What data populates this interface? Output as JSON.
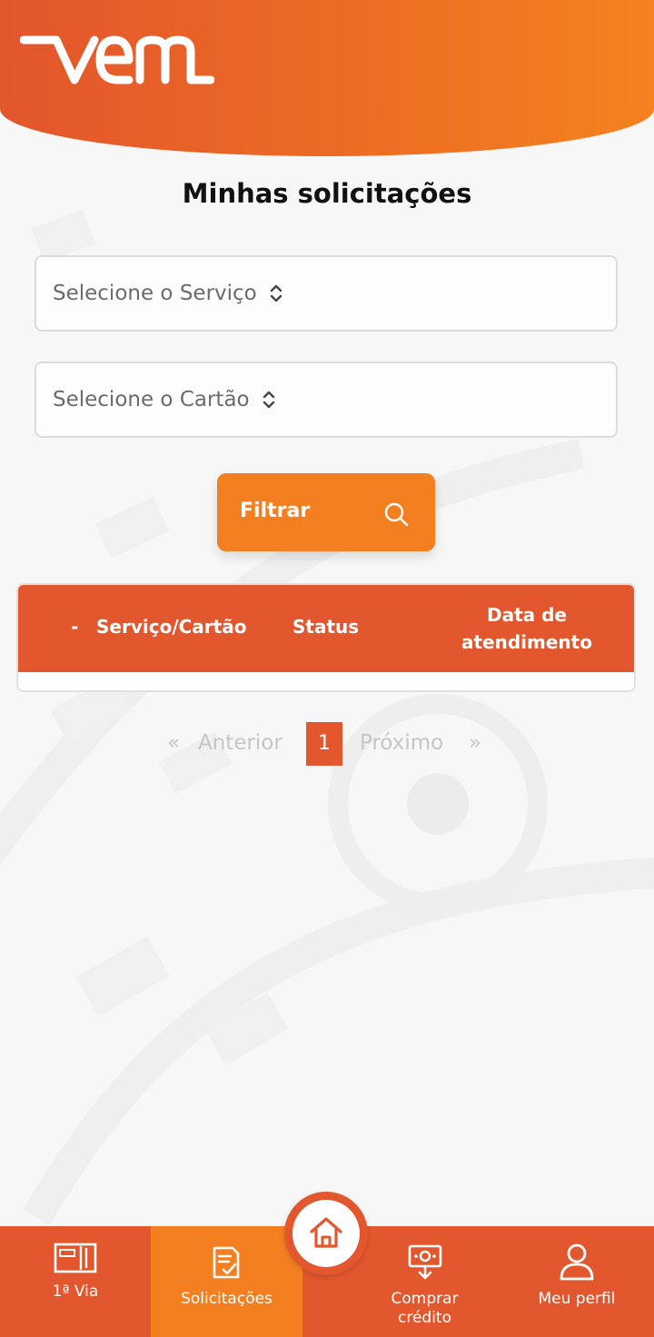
{
  "brand": {
    "logo_text": "vem",
    "primary_color": "#e2572e",
    "accent_color": "#f37f20"
  },
  "page": {
    "title": "Minhas solicitações"
  },
  "filters": {
    "service_select": "Selecione o Serviço",
    "card_select": "Selecione o Cartão",
    "filter_button": "Filtrar",
    "filter_icon": "search-icon"
  },
  "table": {
    "sort_marker": "-",
    "columns": [
      "Serviço/Cartão",
      "Status",
      "Data de",
      "atendimento"
    ],
    "rows": []
  },
  "pagination": {
    "first": "«",
    "previous": "Anterior",
    "current": "1",
    "next": "Próximo",
    "last": "»"
  },
  "bottom_nav": {
    "items": [
      {
        "label": "1ª Via",
        "icon": "card-icon",
        "active": false
      },
      {
        "label": "Solicitações",
        "icon": "document-check-icon",
        "active": true
      },
      {
        "label": "Comprar",
        "label2": "crédito",
        "icon": "buy-credit-icon",
        "active": false
      },
      {
        "label": "Meu perfil",
        "icon": "user-icon",
        "active": false
      }
    ],
    "home_icon": "home-icon"
  }
}
